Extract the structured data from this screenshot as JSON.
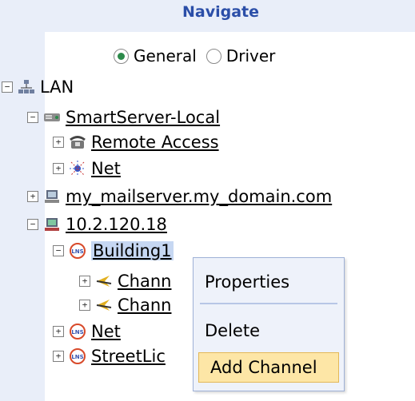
{
  "header": {
    "title": "Navigate"
  },
  "view_mode": {
    "options": [
      {
        "label": "General",
        "selected": true
      },
      {
        "label": "Driver",
        "selected": false
      }
    ]
  },
  "tree": {
    "lan": "LAN",
    "smartserver": "SmartServer-Local",
    "remote_access": "Remote Access",
    "net1": "Net",
    "mailserver": "my_mailserver.my_domain.com",
    "ip": "10.2.120.18",
    "building": "Building1",
    "chan1": "Chann",
    "chan2": "Chann",
    "net2": "Net",
    "street": "StreetLic"
  },
  "context_menu": {
    "properties": "Properties",
    "delete": "Delete",
    "add_channel": "Add Channel"
  },
  "colors": {
    "header_bg": "#e9eef9",
    "header_text": "#2b4ea8",
    "menu_bg": "#eef2fa",
    "menu_hover": "#fde6a6"
  }
}
